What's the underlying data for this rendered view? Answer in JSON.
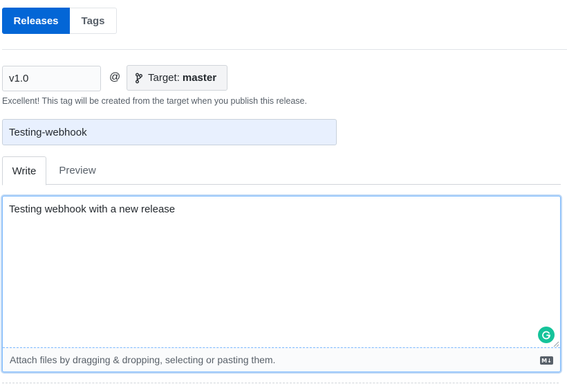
{
  "subnav": {
    "releases_label": "Releases",
    "tags_label": "Tags"
  },
  "tag": {
    "value": "v1.0",
    "at_symbol": "@",
    "target_label": "Target:",
    "target_value": "master",
    "note": "Excellent! This tag will be created from the target when you publish this release."
  },
  "release_title": {
    "value": "Testing-webhook"
  },
  "editor_tabs": {
    "write": "Write",
    "preview": "Preview"
  },
  "body": {
    "value": "Testing webhook with a new release",
    "attach_hint": "Attach files by dragging & dropping, selecting or pasting them.",
    "markdown_badge": "M↓"
  },
  "icons": {
    "branch": "git-branch-icon",
    "grammarly": "grammarly-icon",
    "markdown": "markdown-icon"
  },
  "colors": {
    "primary": "#0366d6",
    "focus_border": "#79b8ff",
    "autofill_bg": "#e8f0fe",
    "grammarly": "#15c39a"
  }
}
